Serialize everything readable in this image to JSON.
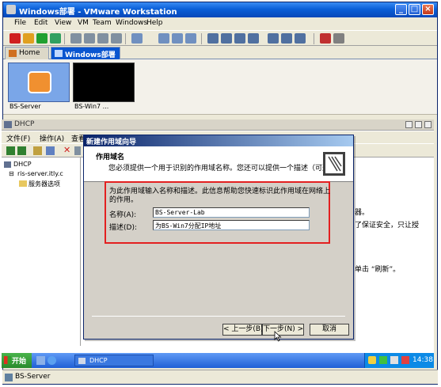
{
  "window": {
    "title": "Windows部署 - VMware Workstation"
  },
  "menu": [
    "File",
    "Edit",
    "View",
    "VM",
    "Team",
    "Windows",
    "Help"
  ],
  "tabs": [
    {
      "label": "Home"
    },
    {
      "label": "Windows部署"
    }
  ],
  "thumbnails": [
    {
      "label": "BS-Server"
    },
    {
      "label": "BS-Win7 ..."
    }
  ],
  "mmc": {
    "title": "DHCP",
    "menu": [
      "文件(F)",
      "操作(A)",
      "查看"
    ],
    "tree": {
      "root": "DHCP",
      "server": "ris-server.itly.c",
      "options": "服务器选项"
    },
    "right_fragments": [
      "器。",
      "了保证安全，只让授",
      "单击 “刷新”。"
    ]
  },
  "wizard": {
    "title": "新建作用域向导",
    "header_title": "作用域名",
    "header_subtitle": "您必须提供一个用于识别的作用域名称。您还可以提供一个描述（可选）。",
    "instruction": "为此作用域输入名称和描述。此信息帮助您快速标识此作用域在网络上的作用。",
    "name_label": "名称(A):",
    "name_value": "BS-Server-Lab",
    "desc_label": "描述(D):",
    "desc_value": "为BS-Win7分配IP地址",
    "back_button": "< 上一步(B)",
    "next_button": "下一步(N) >",
    "cancel_button": "取消"
  },
  "taskbar": {
    "start": "开始",
    "task": "DHCP",
    "clock": "14:38"
  },
  "status": {
    "text": "BS-Server"
  },
  "colors": {
    "highlight_red": "#e32020",
    "xp_blue": "#0a56d0"
  },
  "icons": [
    "vmware-logo-icon",
    "minimize-icon",
    "maximize-icon",
    "close-icon",
    "home-icon",
    "vm-tab-icon",
    "dhcp-icon",
    "folder-icon",
    "wizard-docs-icon",
    "start-flag-icon",
    "server-status-icon"
  ]
}
